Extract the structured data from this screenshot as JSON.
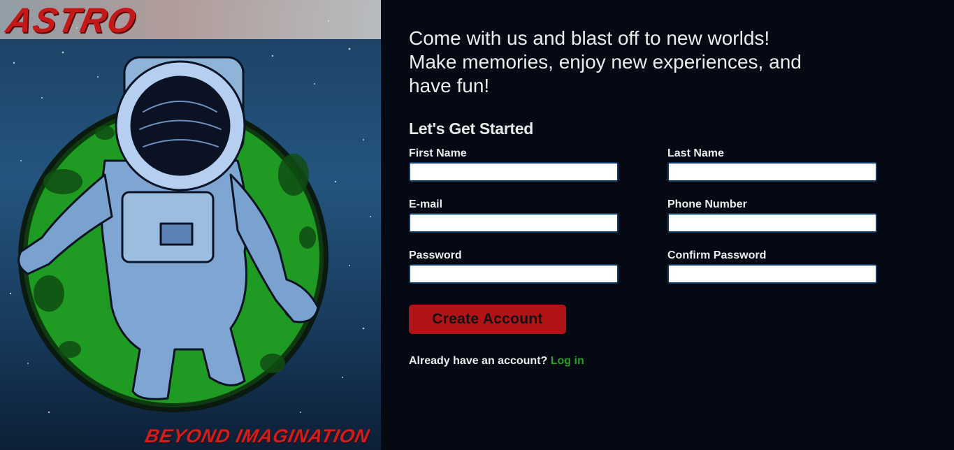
{
  "brand": {
    "logo": "ASTRO",
    "tagline": "BEYOND IMAGINATION"
  },
  "hero": {
    "headline_line1": "Come with us and blast off to new worlds!",
    "headline_line2": "Make memories, enjoy new experiences, and",
    "headline_line3": "have fun!"
  },
  "form": {
    "title": "Let's Get Started",
    "fields": {
      "first_name": {
        "label": "First Name",
        "value": "",
        "placeholder": ""
      },
      "last_name": {
        "label": "Last Name",
        "value": "",
        "placeholder": ""
      },
      "email": {
        "label": "E-mail",
        "value": "",
        "placeholder": ""
      },
      "phone": {
        "label": "Phone Number",
        "value": "",
        "placeholder": ""
      },
      "password": {
        "label": "Password",
        "value": "",
        "placeholder": ""
      },
      "confirm_password": {
        "label": "Confirm Password",
        "value": "",
        "placeholder": ""
      }
    },
    "submit_label": "Create Account",
    "login_prompt": "Already have an account?",
    "login_link": "Log in"
  },
  "colors": {
    "background": "#050913",
    "accent_red": "#b11417",
    "link_green": "#1fa31f",
    "input_border": "#0f3a6c",
    "text": "#ececec"
  },
  "icons": {
    "hero_image": "astronaut-illustration-icon"
  }
}
